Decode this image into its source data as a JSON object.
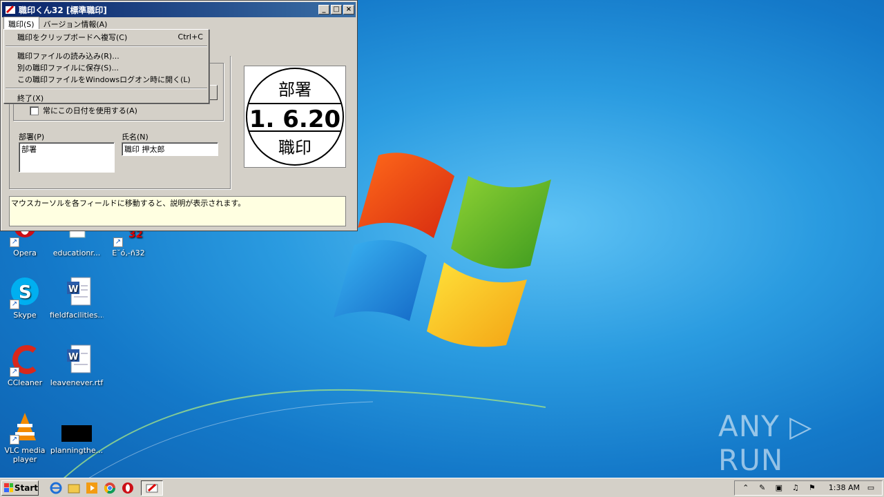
{
  "window": {
    "title": "職印くん32 [標準職印]",
    "min": "_",
    "max": "□",
    "close": "×",
    "menu": [
      {
        "label": "職印(S)"
      },
      {
        "label": "バージョン情報(A)"
      }
    ],
    "dropdown": {
      "items": [
        {
          "label": "職印をクリップボードへ複写(C)",
          "shortcut": "Ctrl+C"
        },
        {
          "label": "職印ファイルの読み込み(R)..."
        },
        {
          "label": "別の職印ファイルに保存(S)..."
        },
        {
          "label": "この職印ファイルをWindowsログオン時に開く(L)"
        },
        {
          "label": "終了(X)"
        }
      ]
    },
    "checkbox_label": "常にこの日付を使用する(A)",
    "dept_label": "部署(P)",
    "dept_value": "部署",
    "name_label": "氏名(N)",
    "name_value": "職印 押太郎",
    "stamp": {
      "top": "部署",
      "date": "1. 6.20",
      "bottom": "職印"
    },
    "status_text": "マウスカーソルを各フィールドに移動すると、説明が表示されます。"
  },
  "desktop": {
    "icons": [
      {
        "label": "Opera"
      },
      {
        "label": "educationr..."
      },
      {
        "label": "E˘ó‚-ñ32"
      },
      {
        "label": "Skype"
      },
      {
        "label": "fieldfacilities..."
      },
      {
        "label": "CCleaner"
      },
      {
        "label": "leavenever.rtf"
      },
      {
        "label": "VLC media player"
      },
      {
        "label": "planningthe..."
      }
    ]
  },
  "watermark": "ANY ▷ RUN",
  "taskbar": {
    "start": "Start",
    "clock": "1:38 AM"
  },
  "colors": {
    "title_start": "#0a246a",
    "title_end": "#3a6ea5",
    "status_bg": "#ffffe1"
  }
}
